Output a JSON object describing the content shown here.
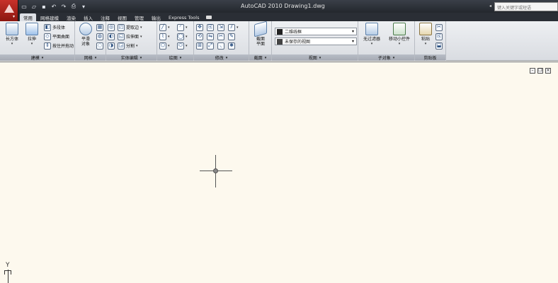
{
  "title": "AutoCAD 2010    Drawing1.dwg",
  "search_placeholder": "键入关键字或短语",
  "qat": [
    "new-icon",
    "open-icon",
    "save-icon",
    "undo-icon",
    "redo-icon",
    "plot-icon",
    "dropdown-icon"
  ],
  "tabs": [
    {
      "label": "常用",
      "active": true
    },
    {
      "label": "网格建模"
    },
    {
      "label": "渲染"
    },
    {
      "label": "插入"
    },
    {
      "label": "注释"
    },
    {
      "label": "视图"
    },
    {
      "label": "管理"
    },
    {
      "label": "输出"
    },
    {
      "label": "Express Tools"
    }
  ],
  "panels": {
    "modeling": {
      "title": "建模",
      "box": "长方体",
      "extrude": "拉伸",
      "polysolid": "多段体",
      "planar": "平面曲面",
      "presspull": "按住并拖动"
    },
    "mesh": {
      "title": "网格",
      "smooth": "平滑\n对象"
    },
    "solid_edit": {
      "title": "实体编辑",
      "extract": "提取边",
      "extrude_face": "拉伸面",
      "separate": "分割"
    },
    "draw": {
      "title": "绘图"
    },
    "modify": {
      "title": "修改"
    },
    "section": {
      "title": "截面",
      "plane": "截面\n平面"
    },
    "view": {
      "title": "视图",
      "visual_style": "二维线框",
      "named_view": "未保存的视图"
    },
    "subobject": {
      "title": "子对象",
      "no_filter": "无过滤器",
      "gizmo": "移动小控件"
    },
    "clipboard": {
      "title": "剪贴板",
      "paste": "粘贴"
    }
  },
  "ucs": {
    "y": "Y"
  }
}
